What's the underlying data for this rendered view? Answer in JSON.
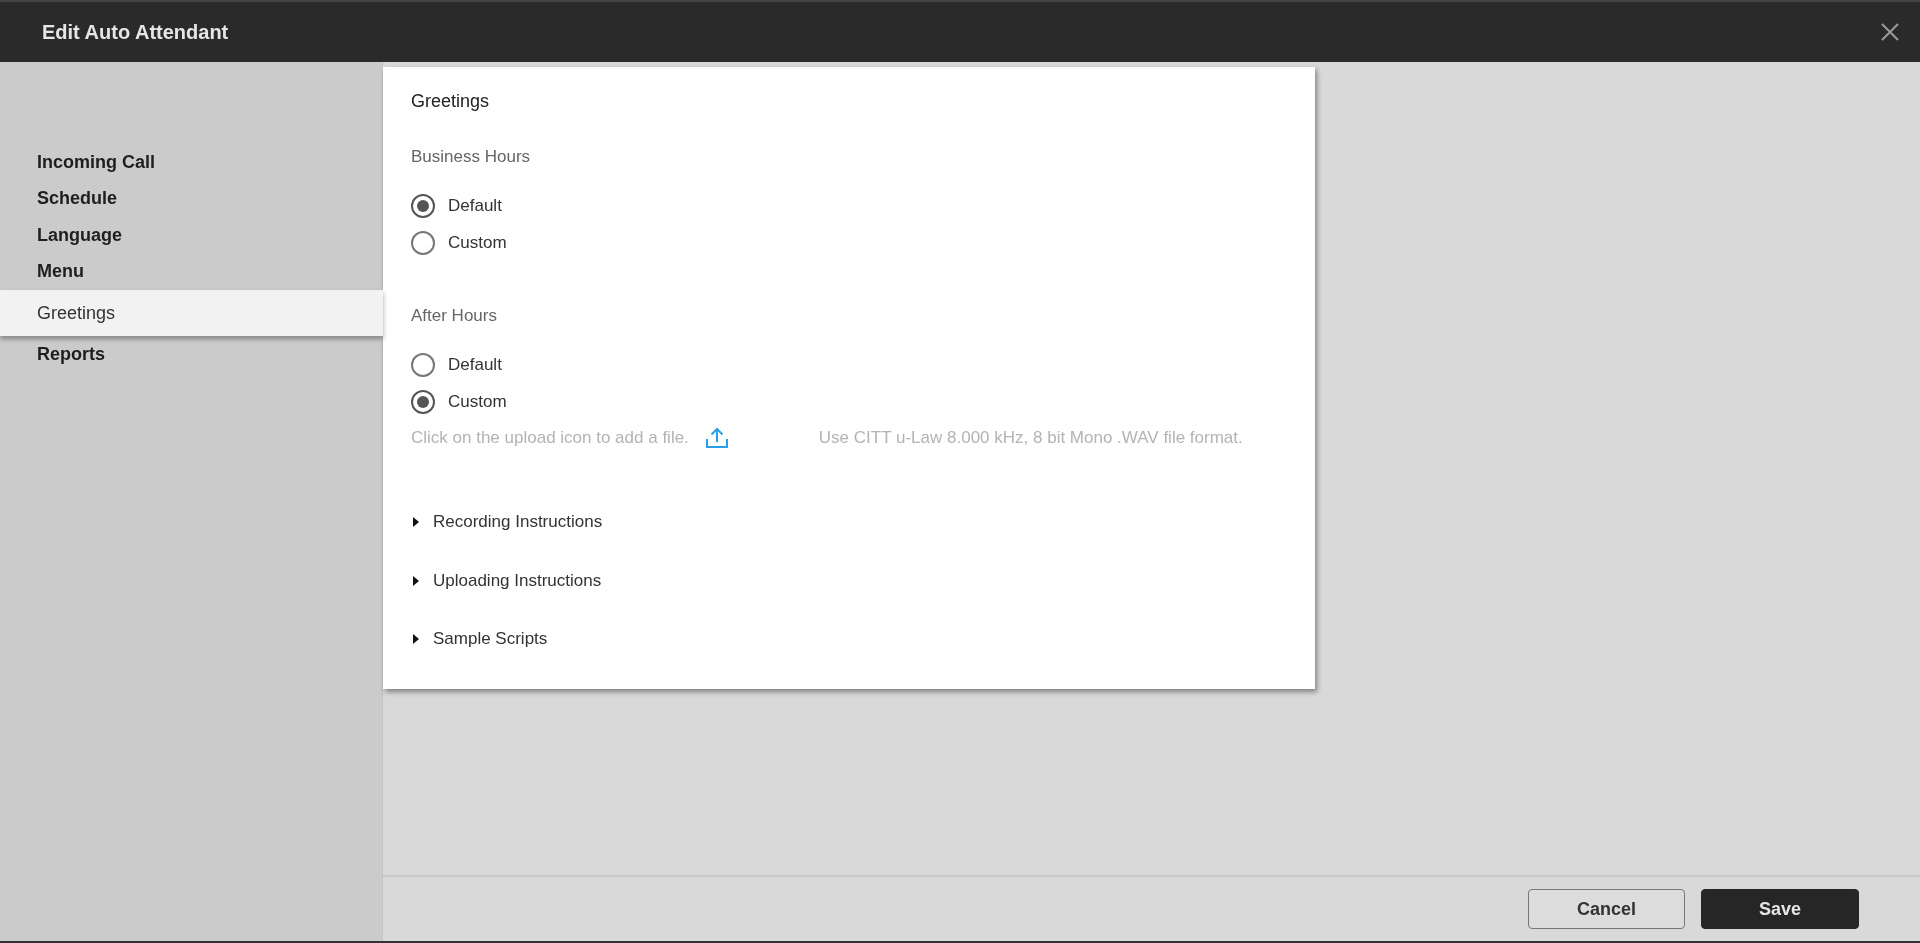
{
  "window": {
    "title": "Edit Auto Attendant"
  },
  "sidebar": {
    "items": [
      {
        "label": "Incoming Call",
        "selected": false
      },
      {
        "label": "Schedule",
        "selected": false
      },
      {
        "label": "Language",
        "selected": false
      },
      {
        "label": "Menu",
        "selected": false
      },
      {
        "label": "Greetings",
        "selected": true
      },
      {
        "label": "Reports",
        "selected": false
      }
    ]
  },
  "card": {
    "title": "Greetings",
    "groups": [
      {
        "label": "Business Hours",
        "options": [
          {
            "label": "Default",
            "selected": true
          },
          {
            "label": "Custom",
            "selected": false
          }
        ]
      },
      {
        "label": "After Hours",
        "options": [
          {
            "label": "Default",
            "selected": false
          },
          {
            "label": "Custom",
            "selected": true
          }
        ],
        "upload_hint": "Click on the upload icon to add a file.",
        "format_note": "Use CITT u-Law 8.000 kHz, 8 bit Mono .WAV file format."
      }
    ],
    "sections": [
      {
        "label": "Recording Instructions",
        "expanded": false
      },
      {
        "label": "Uploading Instructions",
        "expanded": false
      },
      {
        "label": "Sample Scripts",
        "expanded": false
      }
    ]
  },
  "buttons": [
    {
      "label": "Cancel",
      "kind": "secondary"
    },
    {
      "label": "Save",
      "kind": "primary"
    }
  ]
}
